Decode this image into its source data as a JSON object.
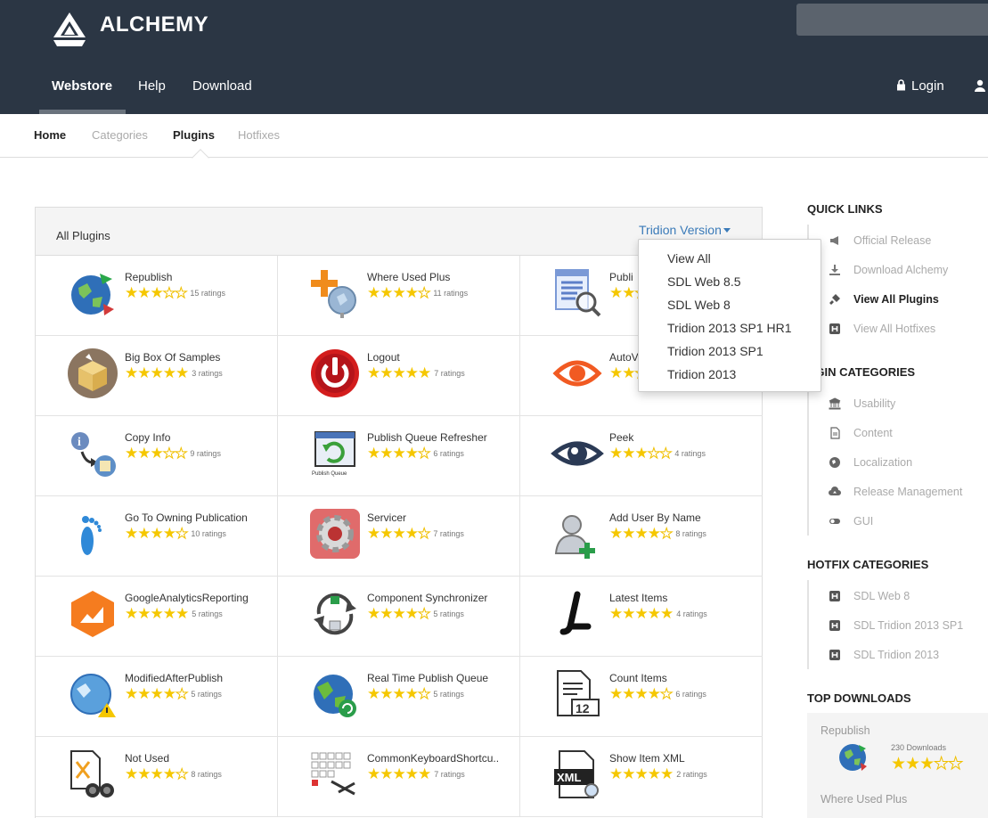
{
  "brand": {
    "name": "ALCHEMY"
  },
  "nav": {
    "items": [
      "Webstore",
      "Help",
      "Download"
    ],
    "login": "Login"
  },
  "subnav": {
    "items": [
      "Home",
      "Categories",
      "Plugins",
      "Hotfixes"
    ]
  },
  "panel": {
    "title": "All Plugins",
    "version_toggle": "Tridion Version",
    "plugins": [
      {
        "name": "Republish",
        "stars": 3,
        "ratings": "15 ratings",
        "icon": "globe-arrows-icon"
      },
      {
        "name": "Where Used Plus",
        "stars": 4,
        "ratings": "11 ratings",
        "icon": "plus-globe-icon"
      },
      {
        "name": "Publish...",
        "display": "Publi",
        "stars": 2,
        "ratings": "",
        "icon": "list-magnifier-icon"
      },
      {
        "name": "Big Box Of Samples",
        "stars": 5,
        "ratings": "3 ratings",
        "icon": "box-icon"
      },
      {
        "name": "Logout",
        "stars": 5,
        "ratings": "7 ratings",
        "icon": "power-icon"
      },
      {
        "name": "AutoV...",
        "display": "AutoV",
        "stars": 2,
        "ratings": "",
        "icon": "eye-orange-icon"
      },
      {
        "name": "Copy Info",
        "stars": 3,
        "ratings": "9 ratings",
        "icon": "info-copy-icon"
      },
      {
        "name": "Publish Queue Refresher",
        "stars": 4,
        "ratings": "6 ratings",
        "icon": "queue-refresh-icon"
      },
      {
        "name": "Peek",
        "stars": 3,
        "ratings": "4 ratings",
        "icon": "eye-icon"
      },
      {
        "name": "Go To Owning Publication",
        "stars": 4,
        "ratings": "10 ratings",
        "icon": "footprint-icon"
      },
      {
        "name": "Servicer",
        "stars": 4,
        "ratings": "7 ratings",
        "icon": "gear-icon"
      },
      {
        "name": "Add User By Name",
        "stars": 4,
        "ratings": "8 ratings",
        "icon": "add-user-icon"
      },
      {
        "name": "GoogleAnalyticsReporting",
        "stars": 5,
        "ratings": "5 ratings",
        "icon": "analytics-icon"
      },
      {
        "name": "Component Synchronizer",
        "stars": 4,
        "ratings": "5 ratings",
        "icon": "sync-icon"
      },
      {
        "name": "Latest Items",
        "stars": 5,
        "ratings": "4 ratings",
        "icon": "letter-l-icon"
      },
      {
        "name": "ModifiedAfterPublish",
        "stars": 4,
        "ratings": "5 ratings",
        "icon": "globe-warning-icon"
      },
      {
        "name": "Real Time Publish Queue",
        "stars": 4,
        "ratings": "5 ratings",
        "icon": "globe-refresh-icon"
      },
      {
        "name": "Count Items",
        "stars": 4,
        "ratings": "6 ratings",
        "icon": "document-count-icon"
      },
      {
        "name": "Not Used",
        "stars": 4,
        "ratings": "8 ratings",
        "icon": "binoculars-icon"
      },
      {
        "name": "CommonKeyboardShortcu..",
        "stars": 5,
        "ratings": "7 ratings",
        "icon": "keyboard-icon"
      },
      {
        "name": "Show Item XML",
        "stars": 5,
        "ratings": "2 ratings",
        "icon": "xml-icon"
      }
    ]
  },
  "version_dropdown": {
    "options": [
      "View All",
      "SDL Web 8.5",
      "SDL Web 8",
      "Tridion 2013 SP1 HR1",
      "Tridion 2013 SP1",
      "Tridion 2013"
    ]
  },
  "sidebar": {
    "quick_links": {
      "title": "QUICK LINKS",
      "items": [
        "Official Release",
        "Download Alchemy",
        "View All Plugins",
        "View All Hotfixes"
      ]
    },
    "plugin_categories": {
      "title": "UGIN CATEGORIES",
      "items": [
        "Usability",
        "Content",
        "Localization",
        "Release Management",
        "GUI"
      ]
    },
    "hotfix_categories": {
      "title": "HOTFIX CATEGORIES",
      "items": [
        "SDL Web 8",
        "SDL Tridion 2013 SP1",
        "SDL Tridion 2013"
      ]
    },
    "top_downloads": {
      "title": "TOP DOWNLOADS",
      "first": "Republish",
      "first_downloads": "230 Downloads",
      "first_stars": 3,
      "second": "Where Used Plus"
    }
  },
  "colors": {
    "header": "#2b3644",
    "link": "#3a7ab8",
    "star": "#f5c700"
  }
}
